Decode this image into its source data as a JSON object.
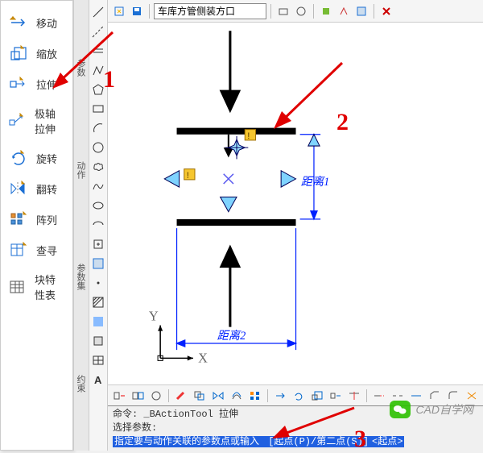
{
  "actions": {
    "move": "移动",
    "scale": "缩放",
    "stretch": "拉伸",
    "polar_stretch": "极轴拉伸",
    "rotate": "旋转",
    "flip": "翻转",
    "array": "阵列",
    "lookup": "查寻",
    "block_prop_table": "块特性表"
  },
  "side_tabs": {
    "params": "参数",
    "actions": "动作",
    "param_sets": "参数集",
    "constraints": "约束"
  },
  "top": {
    "block_name": "车库方管侧装方口"
  },
  "canvas": {
    "dim1": "距离1",
    "dim2": "距离2",
    "axis_x": "X",
    "axis_y": "Y"
  },
  "command": {
    "line1_prefix": "命令: ",
    "line1_cmd": "_BActionTool 拉伸",
    "line2": "选择参数:",
    "line3_prefix": "指定要与动作关联的参数点或输入 ",
    "line3_options": "[起点(P)/第二点(S)]",
    "line3_default": "<起点>"
  },
  "annotations": {
    "n1": "1",
    "n2": "2",
    "n3": "3"
  },
  "watermark": {
    "text": "CAD自学网"
  }
}
